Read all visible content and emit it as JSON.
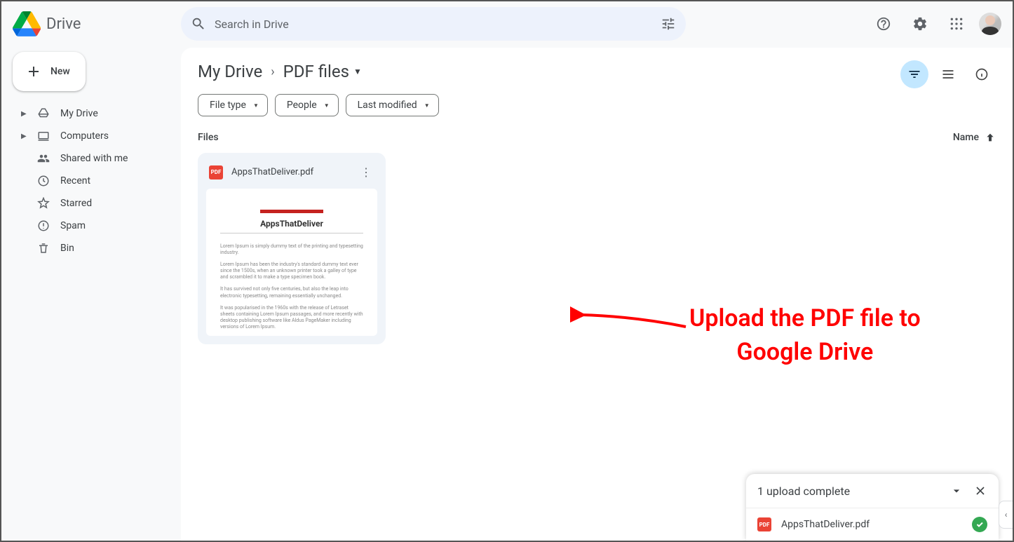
{
  "app": {
    "name": "Drive"
  },
  "search": {
    "placeholder": "Search in Drive"
  },
  "sidebar": {
    "new_label": "New",
    "items": [
      {
        "label": "My Drive"
      },
      {
        "label": "Computers"
      },
      {
        "label": "Shared with me"
      },
      {
        "label": "Recent"
      },
      {
        "label": "Starred"
      },
      {
        "label": "Spam"
      },
      {
        "label": "Bin"
      }
    ]
  },
  "breadcrumb": {
    "root": "My Drive",
    "current": "PDF files"
  },
  "filters": {
    "file_type": "File type",
    "people": "People",
    "last_modified": "Last modified"
  },
  "section": {
    "title": "Files",
    "sort": "Name"
  },
  "files": [
    {
      "name": "AppsThatDeliver.pdf",
      "thumb_title": "AppsThatDeliver"
    }
  ],
  "upload": {
    "title": "1 upload complete",
    "item": "AppsThatDeliver.pdf"
  },
  "annotation": {
    "line1": "Upload the PDF file to",
    "line2": "Google Drive"
  }
}
